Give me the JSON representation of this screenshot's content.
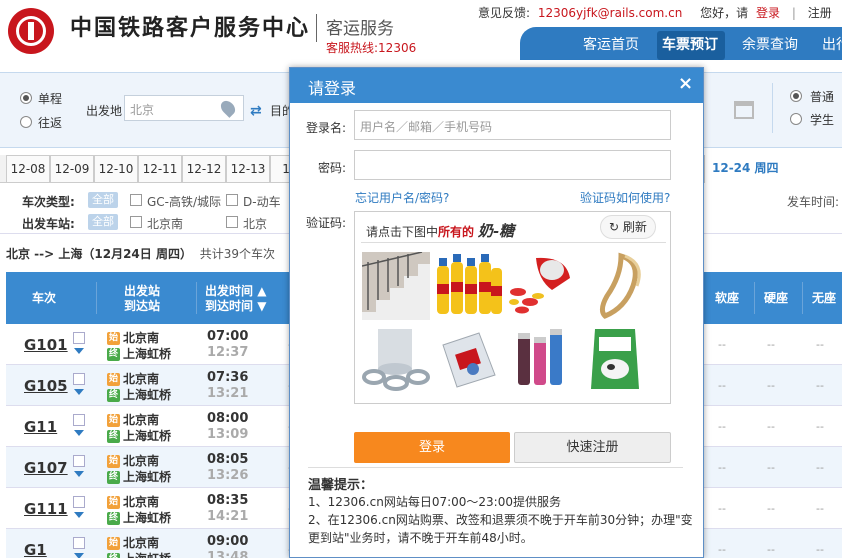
{
  "header": {
    "logo_text": "中国铁路客户服务中心",
    "service": "客运服务",
    "hotline": "客服热线:12306",
    "feedback_label": "意见反馈:",
    "feedback_email": "12306yjfk@rails.com.cn",
    "greeting": "您好，请",
    "login_link": "登录",
    "separator": "|",
    "register_link": "注册",
    "clipped_text": "扌"
  },
  "nav": {
    "items": [
      "客运首页",
      "车票预订",
      "余票查询",
      "出行"
    ],
    "active_index": 1
  },
  "search": {
    "trip_types": [
      "单程",
      "往返"
    ],
    "selected_trip": 0,
    "from_label": "出发地",
    "from_value": "北京",
    "to_label_clip": "目的",
    "passenger_types": [
      "普通",
      "学生"
    ],
    "selected_passenger": 0
  },
  "dates": {
    "tabs": [
      "12-08",
      "12-09",
      "12-10",
      "12-11",
      "12-12",
      "12-13",
      "12-"
    ],
    "selected_label": "12-24 周四"
  },
  "filters": {
    "train_type_label": "车次类型:",
    "all": "全部",
    "train_types": [
      "GC-高铁/城际",
      "D-动车"
    ],
    "station_label": "出发车站:",
    "stations": [
      "北京南",
      "北京"
    ],
    "depart_time_label": "发车时间:"
  },
  "result": {
    "route": "北京 --> 上海（12月24日  周四）",
    "count_text": "共计39个车次"
  },
  "table_headers": {
    "train": "车次",
    "station_top": "出发站",
    "station_bottom": "到达站",
    "time_top": "出发时间",
    "time_bottom": "到达时间",
    "soft_sleeper": "软座",
    "hard_seat": "硬座",
    "no_seat": "无座"
  },
  "station_tags": {
    "start": "始",
    "end": "终"
  },
  "dash": "--",
  "trains": [
    {
      "no": "G101",
      "from": "北京南",
      "to": "上海虹桥",
      "dep": "07:00",
      "arr": "12:37"
    },
    {
      "no": "G105",
      "from": "北京南",
      "to": "上海虹桥",
      "dep": "07:36",
      "arr": "13:21"
    },
    {
      "no": "G11",
      "from": "北京南",
      "to": "上海虹桥",
      "dep": "08:00",
      "arr": "13:09"
    },
    {
      "no": "G107",
      "from": "北京南",
      "to": "上海虹桥",
      "dep": "08:05",
      "arr": "13:26"
    },
    {
      "no": "G111",
      "from": "北京南",
      "to": "上海虹桥",
      "dep": "08:35",
      "arr": "14:21"
    },
    {
      "no": "G1",
      "from": "北京南",
      "to": "上海虹桥",
      "dep": "09:00",
      "arr": "13:48"
    }
  ],
  "modal": {
    "title": "请登录",
    "close": "×",
    "username_label": "登录名:",
    "username_placeholder": "用户名／邮箱／手机号码",
    "password_label": "密码:",
    "forgot_link": "忘记用户名/密码?",
    "captcha_help_link": "验证码如何使用?",
    "captcha_label": "验证码:",
    "captcha_hint": "请点击下图中",
    "captcha_hint_red": "所有的",
    "captcha_word": "奶-糖",
    "refresh_label": "刷新",
    "login_button": "登录",
    "register_button": "快速注册",
    "tips_title": "温馨提示：",
    "tips": [
      "1、12306.cn网站每日07:00～23:00提供服务",
      "2、在12306.cn网站购票、改签和退票须不晚于开车前30分钟；办理\"变更到站\"业务时，请不晚于开车前48小时。"
    ]
  },
  "colors": {
    "brand_red": "#c8161d",
    "nav_blue": "#2f7bc1",
    "header_blue": "#3a8ad0",
    "login_orange": "#f7881e"
  }
}
